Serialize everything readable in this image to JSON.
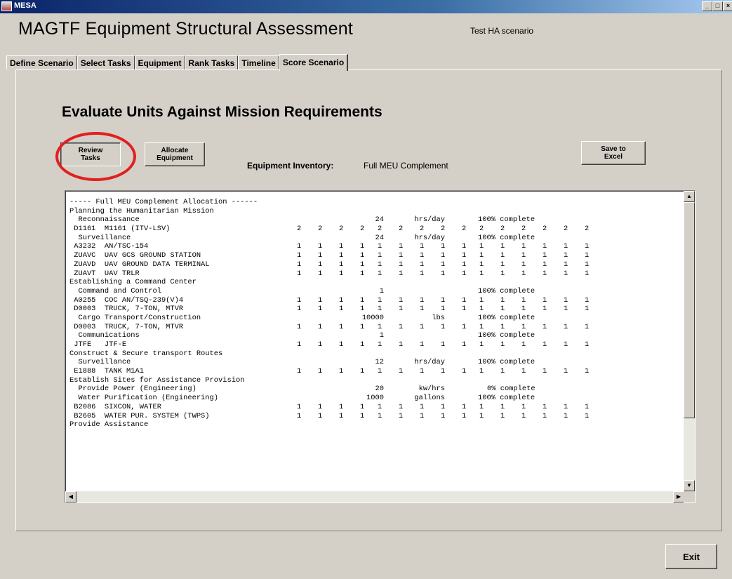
{
  "window": {
    "title": "MESA"
  },
  "header": {
    "app_title": "MAGTF Equipment Structural Assessment",
    "scenario": "Test HA scenario"
  },
  "tabs": [
    {
      "label": "Define Scenario",
      "active": false
    },
    {
      "label": "Select Tasks",
      "active": false
    },
    {
      "label": "Equipment",
      "active": false
    },
    {
      "label": "Rank Tasks",
      "active": false
    },
    {
      "label": "Timeline",
      "active": false
    },
    {
      "label": "Score Scenario",
      "active": true
    }
  ],
  "main": {
    "section_title": "Evaluate Units Against Mission Requirements",
    "review_tasks_label": "Review Tasks",
    "allocate_equipment_label": "Allocate Equipment",
    "save_excel_label": "Save to Excel",
    "inventory_label": "Equipment Inventory:",
    "inventory_value": "Full MEU Complement",
    "exit_label": "Exit"
  },
  "report": {
    "lines": [
      {
        "text": "----- Full MEU Complement Allocation ------"
      },
      {
        "text": "Planning the Humanitarian Mission"
      },
      {
        "text": "  Reconnaissance",
        "amount": "24",
        "unit": "hrs/day",
        "status": "100% complete"
      },
      {
        "text": " D1161  M1161 (ITV-LSV)",
        "values": [
          "2",
          "2",
          "2",
          "2",
          "2",
          "2",
          "2",
          "2",
          "2",
          "2",
          "2",
          "2",
          "2",
          "2",
          "2"
        ]
      },
      {
        "text": "  Surveillance",
        "amount": "24",
        "unit": "hrs/day",
        "status": "100% complete"
      },
      {
        "text": " A3232  AN/TSC-154",
        "values": [
          "1",
          "1",
          "1",
          "1",
          "1",
          "1",
          "1",
          "1",
          "1",
          "1",
          "1",
          "1",
          "1",
          "1",
          "1"
        ]
      },
      {
        "text": " ZUAVC  UAV GCS GROUND STATION",
        "values": [
          "1",
          "1",
          "1",
          "1",
          "1",
          "1",
          "1",
          "1",
          "1",
          "1",
          "1",
          "1",
          "1",
          "1",
          "1"
        ]
      },
      {
        "text": " ZUAVD  UAV GROUND DATA TERMINAL",
        "values": [
          "1",
          "1",
          "1",
          "1",
          "1",
          "1",
          "1",
          "1",
          "1",
          "1",
          "1",
          "1",
          "1",
          "1",
          "1"
        ]
      },
      {
        "text": " ZUAVT  UAV TRLR",
        "values": [
          "1",
          "1",
          "1",
          "1",
          "1",
          "1",
          "1",
          "1",
          "1",
          "1",
          "1",
          "1",
          "1",
          "1",
          "1"
        ]
      },
      {
        "text": "Establishing a Command Center"
      },
      {
        "text": "  Command and Control",
        "amount": "1",
        "unit": "",
        "status": "100% complete"
      },
      {
        "text": " A0255  COC AN/TSQ-239(V)4",
        "values": [
          "1",
          "1",
          "1",
          "1",
          "1",
          "1",
          "1",
          "1",
          "1",
          "1",
          "1",
          "1",
          "1",
          "1",
          "1"
        ]
      },
      {
        "text": " D0003  TRUCK, 7-TON, MTVR",
        "values": [
          "1",
          "1",
          "1",
          "1",
          "1",
          "1",
          "1",
          "1",
          "1",
          "1",
          "1",
          "1",
          "1",
          "1",
          "1"
        ]
      },
      {
        "text": "  Cargo Transport/Construction",
        "amount": "10000",
        "unit": "lbs",
        "status": "100% complete"
      },
      {
        "text": " D0003  TRUCK, 7-TON, MTVR",
        "values": [
          "1",
          "1",
          "1",
          "1",
          "1",
          "1",
          "1",
          "1",
          "1",
          "1",
          "1",
          "1",
          "1",
          "1",
          "1"
        ]
      },
      {
        "text": "  Communications",
        "amount": "1",
        "unit": "",
        "status": "100% complete"
      },
      {
        "text": " JTFE   JTF-E",
        "values": [
          "1",
          "1",
          "1",
          "1",
          "1",
          "1",
          "1",
          "1",
          "1",
          "1",
          "1",
          "1",
          "1",
          "1",
          "1"
        ]
      },
      {
        "text": "Construct & Secure transport Routes"
      },
      {
        "text": "  Surveillance",
        "amount": "12",
        "unit": "hrs/day",
        "status": "100% complete"
      },
      {
        "text": " E1888  TANK M1A1",
        "values": [
          "1",
          "1",
          "1",
          "1",
          "1",
          "1",
          "1",
          "1",
          "1",
          "1",
          "1",
          "1",
          "1",
          "1",
          "1"
        ]
      },
      {
        "text": "Establish Sites for Assistance Provision"
      },
      {
        "text": "  Provide Power (Engineering)",
        "amount": "20",
        "unit": "kw/hrs",
        "status": "0% complete"
      },
      {
        "text": "  Water Purification (Engineering)",
        "amount": "1000",
        "unit": "gallons",
        "status": "100% complete"
      },
      {
        "text": " B2086  SIXCON, WATER",
        "values": [
          "1",
          "1",
          "1",
          "1",
          "1",
          "1",
          "1",
          "1",
          "1",
          "1",
          "1",
          "1",
          "1",
          "1",
          "1"
        ]
      },
      {
        "text": " B2605  WATER PUR. SYSTEM (TWPS)",
        "values": [
          "1",
          "1",
          "1",
          "1",
          "1",
          "1",
          "1",
          "1",
          "1",
          "1",
          "1",
          "1",
          "1",
          "1",
          "1"
        ]
      },
      {
        "text": "Provide Assistance"
      }
    ]
  },
  "icons": {
    "minimize": "minimize-icon",
    "maximize": "maximize-icon",
    "close": "close-icon"
  },
  "colors": {
    "window_bg": "#d4d0c8",
    "highlight_ring": "#e02020",
    "titlebar": "#0a246a"
  }
}
